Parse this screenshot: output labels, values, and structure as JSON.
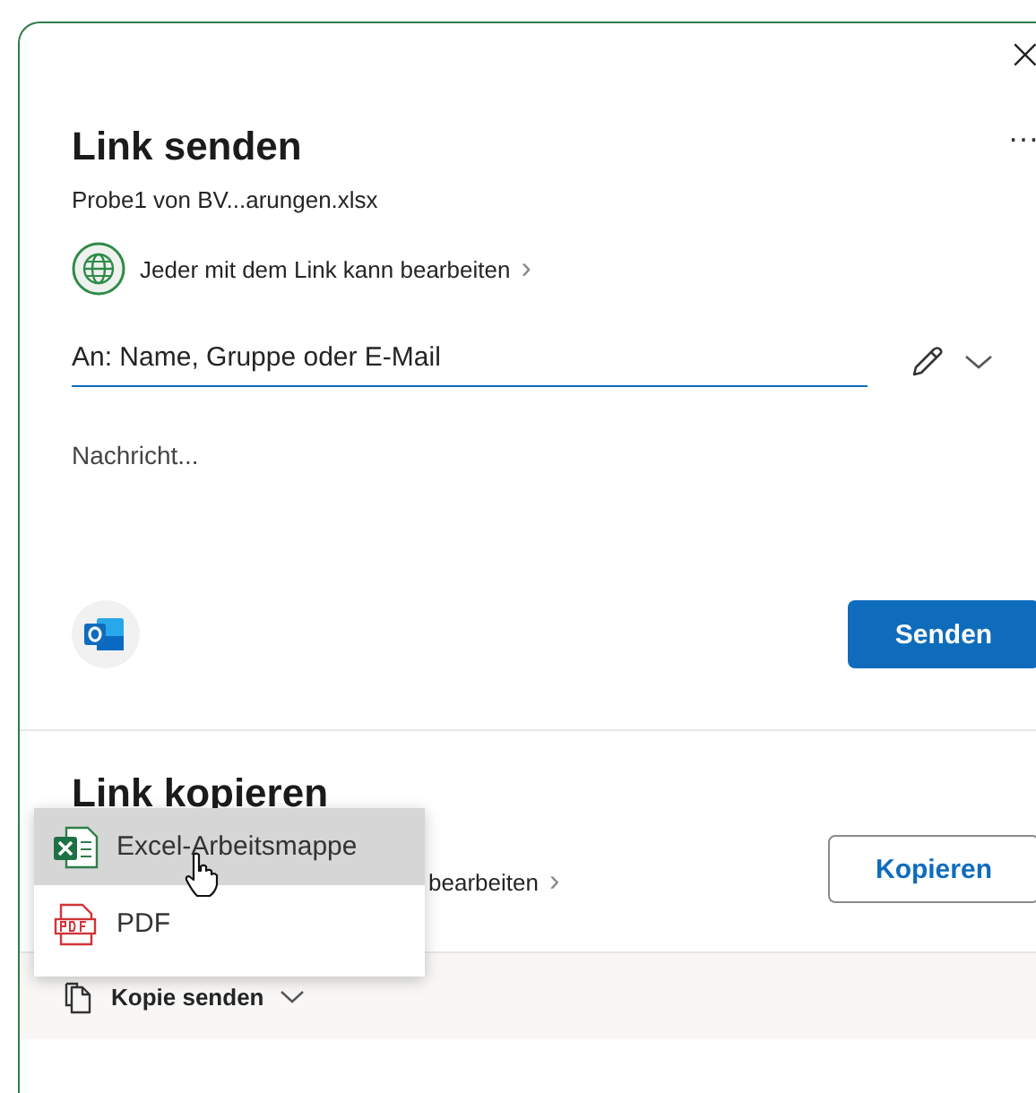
{
  "dialog": {
    "close": "×",
    "more": "…"
  },
  "send_link": {
    "title": "Link senden",
    "file_name": "Probe1 von BV...arungen.xlsx",
    "permission": "Jeder mit dem Link kann bearbeiten",
    "chevron": "›",
    "to_field": {
      "placeholder": "An: Name, Gruppe oder E-Mail"
    },
    "message": {
      "placeholder": "Nachricht..."
    },
    "send_button": "Senden"
  },
  "copy_link": {
    "title": "Link kopieren",
    "permission_visible": "bearbeiten",
    "chevron": "›",
    "copy_button": "Kopieren"
  },
  "menu": {
    "items": [
      {
        "kind": "excel",
        "label": "Excel-Arbeitsmappe",
        "selected": true
      },
      {
        "kind": "pdf",
        "label": "PDF",
        "selected": false
      }
    ]
  },
  "footer": {
    "label": "Kopie senden"
  }
}
